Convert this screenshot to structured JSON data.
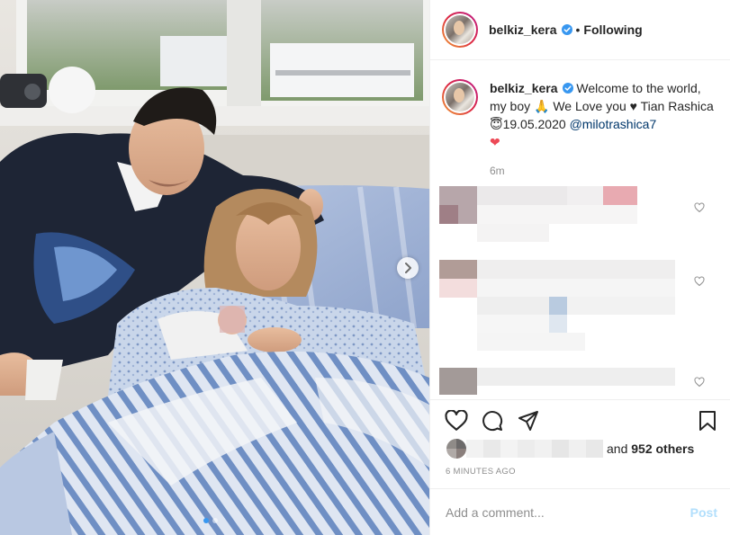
{
  "post": {
    "username": "belkiz_kera",
    "follow_status": "Following",
    "separator": "•",
    "caption_text": "Welcome to the world, my boy 🙏 We Love you ♥ Tian Rashica 😇19.05.2020",
    "caption_mention": "@milotrashica7",
    "caption_tail_emoji": "❤",
    "caption_age": "6m",
    "likes_suffix_prefix": "and",
    "likes_others": "952 others",
    "timestamp": "6 MINUTES AGO",
    "carousel": {
      "slide_count": 2,
      "active_index": 0
    }
  },
  "comment_box": {
    "placeholder": "Add a comment...",
    "post_label": "Post"
  },
  "icons": {
    "verified": "verified-badge-icon",
    "like": "heart-icon",
    "comment": "comment-icon",
    "share": "paper-plane-icon",
    "save": "bookmark-icon",
    "next": "chevron-right-icon",
    "comment_like": "small-heart-icon"
  },
  "colors": {
    "verified_blue": "#3897f0",
    "mention_blue": "#00376b",
    "post_disabled": "#b2dffc",
    "muted_text": "#8e8e8e",
    "divider": "#efefef"
  }
}
